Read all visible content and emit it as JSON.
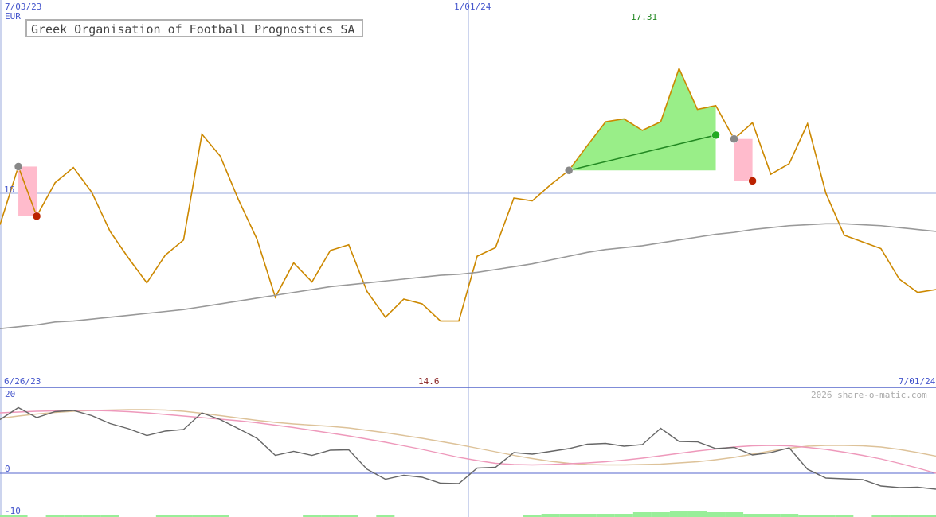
{
  "chart_data": [
    {
      "type": "line",
      "title": "Greek Organisation of Football Prognostics SA",
      "currency": "EUR",
      "date_labels": {
        "top_left": "7/03/23",
        "top_mid": "1/01/24",
        "bottom_left": "6/26/23",
        "bottom_right": "7/01/24"
      },
      "max_label": "17.31",
      "min_label": "14.6",
      "ref_label": "16",
      "x": [
        0,
        1,
        2,
        3,
        4,
        5,
        6,
        7,
        8,
        9,
        10,
        11,
        12,
        13,
        14,
        15,
        16,
        17,
        18,
        19,
        20,
        21,
        22,
        23,
        24,
        25,
        26,
        27,
        28,
        29,
        30,
        31,
        32,
        33,
        34,
        35,
        36,
        37,
        38,
        39,
        40,
        41,
        42,
        43,
        44,
        45,
        46,
        47,
        48,
        49,
        50,
        51
      ],
      "series": [
        {
          "name": "",
          "color": "#cc8800",
          "values": [
            15.67,
            16.28,
            15.76,
            16.11,
            16.27,
            16.01,
            15.6,
            15.32,
            15.06,
            15.35,
            15.51,
            16.62,
            16.39,
            15.93,
            15.52,
            14.91,
            15.27,
            15.07,
            15.4,
            15.46,
            14.97,
            14.7,
            14.89,
            14.84,
            14.66,
            14.66,
            15.34,
            15.43,
            15.95,
            15.92,
            16.09,
            16.24,
            16.5,
            16.75,
            16.78,
            16.66,
            16.75,
            17.31,
            16.88,
            16.92,
            16.57,
            16.74,
            16.2,
            16.31,
            16.73,
            16.0,
            15.56,
            15.49,
            15.42,
            15.1,
            14.96,
            14.99
          ]
        },
        {
          "name": "",
          "color": "#999999",
          "values": [
            14.58,
            14.6,
            14.62,
            14.65,
            14.66,
            14.68,
            14.7,
            14.72,
            14.74,
            14.76,
            14.78,
            14.81,
            14.84,
            14.87,
            14.9,
            14.93,
            14.96,
            14.99,
            15.02,
            15.04,
            15.06,
            15.08,
            15.1,
            15.12,
            15.14,
            15.15,
            15.17,
            15.2,
            15.23,
            15.26,
            15.3,
            15.34,
            15.38,
            15.41,
            15.43,
            15.45,
            15.48,
            15.51,
            15.54,
            15.57,
            15.59,
            15.62,
            15.64,
            15.66,
            15.67,
            15.68,
            15.68,
            15.67,
            15.66,
            15.64,
            15.62,
            15.6
          ]
        }
      ],
      "markers": [
        {
          "x": 1,
          "y": 16.28,
          "kind": "entry",
          "color": "#888888"
        },
        {
          "x": 2,
          "y": 15.76,
          "kind": "exit-loss",
          "color": "#bb2200"
        },
        {
          "x": 31,
          "y": 16.24,
          "kind": "entry",
          "color": "#888888"
        },
        {
          "x": 39,
          "y": 16.61,
          "kind": "exit-gain",
          "color": "#22aa22"
        },
        {
          "x": 40,
          "y": 16.57,
          "kind": "entry",
          "color": "#888888"
        },
        {
          "x": 41,
          "y": 16.13,
          "kind": "exit-loss",
          "color": "#bb2200"
        }
      ],
      "grid": false
    },
    {
      "type": "line",
      "watermark": "2026 share-o-matic.com",
      "tick_labels": [
        "20",
        "0",
        "-10"
      ],
      "ylim": [
        -10,
        20
      ],
      "series": [
        {
          "name": "",
          "color": "#666666",
          "values": [
            13.5,
            16.5,
            14,
            15.5,
            15.8,
            14.5,
            12.5,
            11.2,
            9.5,
            10.6,
            11,
            15.2,
            13.5,
            11.2,
            8.8,
            4.5,
            5.5,
            4.5,
            5.8,
            5.9,
            1,
            -1.5,
            -0.5,
            -1,
            -2.5,
            -2.6,
            1.3,
            1.5,
            5.2,
            4.8,
            5.5,
            6.2,
            7.3,
            7.5,
            6.8,
            7.2,
            11.3,
            8,
            7.9,
            6.2,
            6.5,
            4.6,
            5.2,
            6.4,
            1,
            -1.2,
            -1.4,
            -1.6,
            -3.2,
            -3.6,
            -3.5,
            -4
          ]
        },
        {
          "name": "",
          "color": "#ee99bb",
          "values": [
            15.2,
            15.4,
            15.6,
            15.7,
            15.8,
            15.8,
            15.7,
            15.5,
            15.2,
            14.8,
            14.4,
            14,
            13.6,
            13.2,
            12.7,
            12.1,
            11.5,
            10.8,
            10.1,
            9.4,
            8.6,
            7.8,
            6.9,
            6,
            5,
            4,
            3.2,
            2.5,
            2.2,
            2.1,
            2.2,
            2.4,
            2.6,
            2.9,
            3.3,
            3.8,
            4.4,
            5,
            5.6,
            6.1,
            6.6,
            6.9,
            7,
            6.9,
            6.5,
            6,
            5.3,
            4.5,
            3.6,
            2.5,
            1.3,
            0
          ]
        },
        {
          "name": "",
          "color": "#ddc299",
          "values": [
            13.8,
            14.4,
            14.9,
            15.3,
            15.6,
            15.8,
            15.9,
            16,
            16,
            15.9,
            15.6,
            15.1,
            14.5,
            13.9,
            13.3,
            12.8,
            12.4,
            12.1,
            11.8,
            11.4,
            10.8,
            10.2,
            9.5,
            8.8,
            8,
            7.2,
            6.3,
            5.4,
            4.5,
            3.7,
            3,
            2.5,
            2.2,
            2.1,
            2.1,
            2.2,
            2.3,
            2.6,
            2.9,
            3.4,
            4,
            4.8,
            5.6,
            6.3,
            6.8,
            7,
            7,
            6.9,
            6.6,
            6,
            5.2,
            4.3
          ]
        }
      ],
      "volume": [
        1,
        1,
        0,
        1,
        1,
        1,
        1,
        0,
        0,
        1,
        1,
        1,
        1,
        0,
        0,
        0,
        0,
        1,
        1,
        1,
        0,
        1,
        0,
        0,
        0,
        0,
        0,
        0,
        0,
        1,
        2,
        2,
        2,
        2,
        2,
        3,
        3,
        4,
        4,
        3,
        3,
        2,
        2,
        2,
        1,
        1,
        1,
        0,
        1,
        1,
        1,
        1
      ]
    }
  ]
}
